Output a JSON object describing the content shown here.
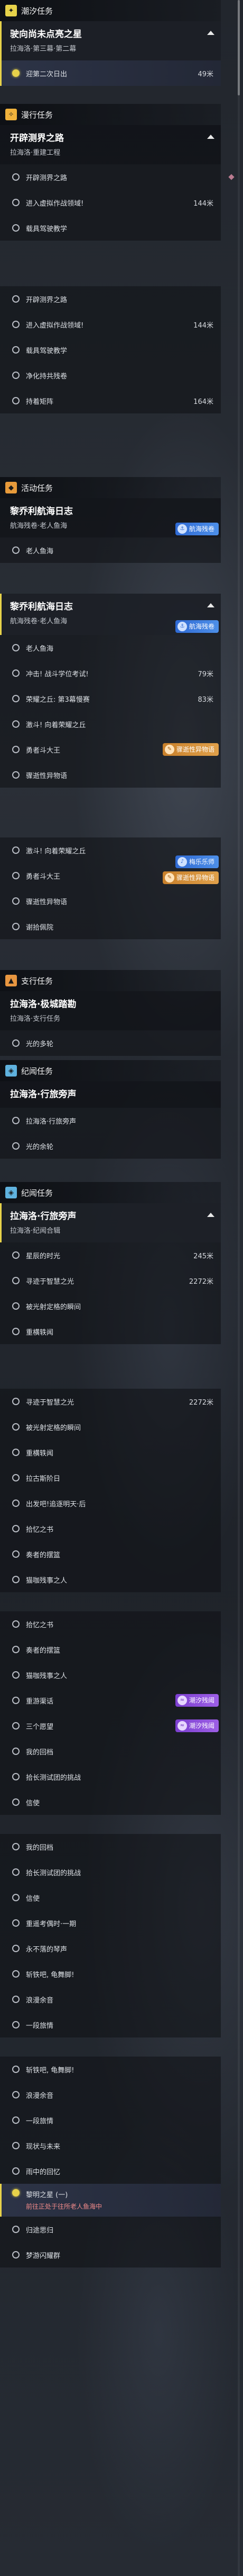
{
  "colors": {
    "accent_yellow": "#e7d24a",
    "tide_quest": "#e7d24a",
    "explore_quest": "#f0b23c",
    "event_quest": "#e79a3a",
    "side_quest": "#e89640",
    "story_quest": "#5fb2de",
    "badge_blue": "#2f6ad4",
    "badge_orange": "#c8802b",
    "badge_purple": "#7c3fd0"
  },
  "sections": {
    "tide": {
      "label": "潮汐任务",
      "icon": "tide-icon",
      "quest": {
        "title": "驶向尚未点亮之星",
        "sub": "拉海洛·第三幕·第二幕"
      },
      "objective": {
        "label": "迎第二次日出",
        "dist": "49米"
      }
    },
    "explore1": {
      "label": "漫行任务",
      "icon": "explore-icon",
      "quest": {
        "title": "开辟测界之路",
        "sub": "拉海洛·重建工程"
      },
      "objectives": [
        {
          "label": "开辟测界之路"
        },
        {
          "label": "进入虚拟作战领域!",
          "dist": "144米"
        },
        {
          "label": "载具驾驶教学"
        }
      ]
    },
    "explore2": {
      "objectives": [
        {
          "label": "开辟测界之路"
        },
        {
          "label": "进入虚拟作战领域!",
          "dist": "144米"
        },
        {
          "label": "载具驾驶教学"
        },
        {
          "label": "净化持共残卷"
        },
        {
          "label": "持着矩阵",
          "dist": "164米"
        }
      ]
    },
    "event1": {
      "label": "活动任务",
      "icon": "event-icon",
      "quest": {
        "title": "黎乔利航海日志",
        "sub": "航海残卷·老人鱼海"
      },
      "badge": "航海残卷",
      "objectives": [
        {
          "label": "老人鱼海"
        }
      ]
    },
    "event2": {
      "quest": {
        "title": "黎乔利航海日志",
        "sub": "航海残卷·老人鱼海"
      },
      "badge": "航海残卷",
      "badge2": "骤逝性异物语",
      "objectives": [
        {
          "label": "老人鱼海"
        },
        {
          "label": "冲击! 战斗学位考试!",
          "dist": "79米"
        },
        {
          "label": "荣耀之丘: 第3幕慢赛",
          "dist": "83米"
        },
        {
          "label": "激斗! 向着荣耀之丘"
        },
        {
          "label": "勇者斗大王"
        },
        {
          "label": "骤逝性异物语"
        }
      ]
    },
    "event3": {
      "badge": "梅乐乐师",
      "badge2": "骤逝性异物语",
      "objectives": [
        {
          "label": "激斗! 向着荣耀之丘"
        },
        {
          "label": "勇者斗大王"
        },
        {
          "label": "骤逝性异物语"
        },
        {
          "label": "谢拾佩院"
        }
      ]
    },
    "side": {
      "label": "支行任务",
      "icon": "side-icon",
      "quest": {
        "title": "拉海洛·极城踏勘",
        "sub": "拉海洛·支行任务"
      },
      "objectives": [
        {
          "label": "光的多轮"
        }
      ]
    },
    "story1": {
      "label": "纪闻任务",
      "icon": "story-icon",
      "quest": {
        "title": "拉海洛·行旅旁声",
        "sub": ""
      },
      "objectives": [
        {
          "label": "拉海洛·行旅旁声"
        },
        {
          "label": "光的余轮"
        }
      ]
    },
    "story2": {
      "label": "纪闻任务",
      "icon": "story-icon",
      "quest": {
        "title": "拉海洛·行旅旁声",
        "sub": "拉海洛·纪闻合辑"
      },
      "objectives": [
        {
          "label": "星辰的时光",
          "dist": "245米"
        },
        {
          "label": "寻迹于智慧之光",
          "dist": "2272米"
        },
        {
          "label": "被光射定格的瞬间"
        },
        {
          "label": "重横轶闻"
        }
      ]
    },
    "story3": {
      "objectives": [
        {
          "label": "寻迹于智慧之光",
          "dist": "2272米"
        },
        {
          "label": "被光射定格的瞬间"
        },
        {
          "label": "重横轶闻"
        },
        {
          "label": "拉古斯阶日"
        },
        {
          "label": "出发吧!追逐明天·后"
        },
        {
          "label": "拾忆之书"
        },
        {
          "label": "奏者的摆篮"
        },
        {
          "label": "猫咖残事之人"
        }
      ]
    },
    "story4": {
      "badge": "潮汐残阈",
      "objectives": [
        {
          "label": "拾忆之书"
        },
        {
          "label": "奏者的摆篮"
        },
        {
          "label": "猫咖残事之人"
        },
        {
          "label": "重游渠话"
        },
        {
          "label": "三个愿望"
        },
        {
          "label": "我的回档"
        },
        {
          "label": "拾长测试团的挑战"
        },
        {
          "label": "信使"
        }
      ]
    },
    "story5": {
      "objectives": [
        {
          "label": "我的回档"
        },
        {
          "label": "拾长测试团的挑战"
        },
        {
          "label": "信使"
        },
        {
          "label": "重遥考偶时·一期"
        },
        {
          "label": "永不落的琴声"
        },
        {
          "label": "斩铁吧, 龟舞脚!"
        },
        {
          "label": "浪漫余音"
        },
        {
          "label": "一段旅情"
        }
      ]
    },
    "story6": {
      "objectives": [
        {
          "label": "斩铁吧, 龟舞脚!"
        },
        {
          "label": "浪漫余音"
        },
        {
          "label": "一段旅情"
        },
        {
          "label": "现状与未来"
        },
        {
          "label": "雨中的回忆"
        },
        {
          "label": "黎明之星 (一)",
          "warn": "前往正处于往所老人鱼海中"
        },
        {
          "label": "归途思归"
        },
        {
          "label": "梦游闪耀群"
        }
      ]
    }
  },
  "tide_badge_label": "潮汐残阈"
}
